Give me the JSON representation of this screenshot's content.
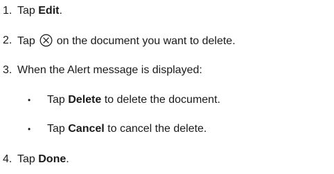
{
  "steps": [
    {
      "number": "1.",
      "pre": "Tap ",
      "bold": "Edit",
      "post": "."
    },
    {
      "number": "2.",
      "pre": "Tap ",
      "post": " on the document you want to delete.",
      "icon": "circled-x-icon"
    },
    {
      "number": "3.",
      "text": "When the Alert message is displayed:",
      "substeps": [
        {
          "pre": "Tap ",
          "bold": "Delete",
          "post": " to delete the document."
        },
        {
          "pre": "Tap ",
          "bold": "Cancel",
          "post": " to cancel the delete."
        }
      ]
    },
    {
      "number": "4.",
      "pre": "Tap ",
      "bold": "Done",
      "post": "."
    }
  ],
  "bullet_symbol": "•"
}
